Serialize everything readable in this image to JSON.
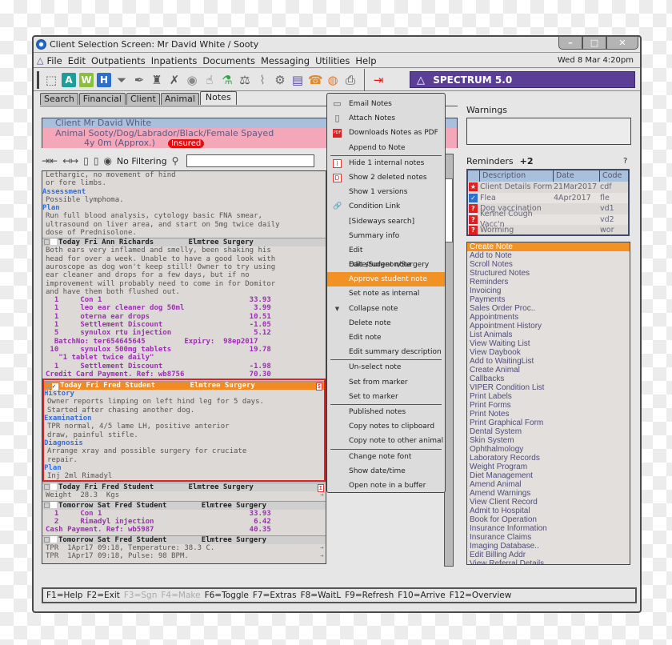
{
  "window": {
    "title": "Client Selection Screen: Mr David White / Sooty",
    "controls": [
      "–",
      "□",
      "✕"
    ]
  },
  "menubar": {
    "items": [
      "File",
      "Edit",
      "Outpatients",
      "Inpatients",
      "Documents",
      "Messaging",
      "Utilities",
      "Help"
    ],
    "datetime": "Wed 8 Mar 4:20pm"
  },
  "toolbar": {
    "icons": [
      {
        "name": "select-area-icon",
        "glyph": "⬚",
        "color": "#555555"
      },
      {
        "name": "a-icon",
        "glyph": "A",
        "color": "#1f9d9a",
        "letter": true
      },
      {
        "name": "w-icon",
        "glyph": "W",
        "color": "#8cbf3f",
        "letter": true
      },
      {
        "name": "h-icon",
        "glyph": "H",
        "color": "#2d6fc9",
        "letter": true
      },
      {
        "name": "funnel-icon",
        "glyph": "⏷",
        "color": "#666666"
      },
      {
        "name": "pen-icon",
        "glyph": "✒",
        "color": "#666666"
      },
      {
        "name": "tooth-icon",
        "glyph": "♜",
        "color": "#555555"
      },
      {
        "name": "figure-icon",
        "glyph": "✗",
        "color": "#555555"
      },
      {
        "name": "eye-icon",
        "glyph": "◉",
        "color": "#888888"
      },
      {
        "name": "glove-icon",
        "glyph": "☝",
        "color": "#666666"
      },
      {
        "name": "flask-icon",
        "glyph": "⚗",
        "color": "#3aa14b"
      },
      {
        "name": "scale-icon",
        "glyph": "⚖",
        "color": "#555555"
      },
      {
        "name": "paperclip-icon",
        "glyph": "⌇",
        "color": "#888888"
      },
      {
        "name": "gears-icon",
        "glyph": "⚙",
        "color": "#666666"
      },
      {
        "name": "chart-doc-icon",
        "glyph": "▤",
        "color": "#5a4fa0"
      },
      {
        "name": "phone-bell-icon",
        "glyph": "☎",
        "color": "#e08a2a"
      },
      {
        "name": "lifebuoy-icon",
        "glyph": "◍",
        "color": "#e87722"
      },
      {
        "name": "printer-icon",
        "glyph": "⎙",
        "color": "#444444"
      }
    ],
    "exit_icon": {
      "name": "exit-door-icon",
      "glyph": "⇥",
      "color": "#e02020"
    },
    "brand": "SPECTRUM 5.0",
    "brand_color": "#5b3f97"
  },
  "tabs": [
    {
      "label": "Search",
      "active": false
    },
    {
      "label": "Financial",
      "active": false
    },
    {
      "label": "Client",
      "active": false
    },
    {
      "label": "Animal",
      "active": false
    },
    {
      "label": "Notes",
      "active": true
    }
  ],
  "client_info": {
    "client": "Client  Mr David White",
    "animal": "Animal Sooty/Dog/Labrador/Black/Female Spayed",
    "age": "4y 0m (Approx.)",
    "badge": "Insured"
  },
  "filterbar": {
    "filter_label": "No Filtering",
    "search_value": ""
  },
  "notes": {
    "top_lines": [
      {
        "t": "Lethargic, no movement of hind",
        "k": "text"
      },
      {
        "t": "or fore limbs.",
        "k": "text"
      },
      {
        "t": "Assessment",
        "k": "sec"
      },
      {
        "t": "Possible lymphoma.",
        "k": "text"
      },
      {
        "t": "Plan",
        "k": "sec"
      },
      {
        "t": "Run full blood analysis, cytology basic FNA smear,",
        "k": "text"
      },
      {
        "t": "ultrasound on liver area, and start on 5mg twice daily",
        "k": "text"
      },
      {
        "t": "dose of Prednisolone.",
        "k": "text"
      }
    ],
    "entries": [
      {
        "header": "Today Fri Ann Richards        Elmtree Surgery",
        "selected": false,
        "checked": false,
        "flag": "",
        "lines": [
          {
            "t": "Both ears very inflamed and smelly, been shaking his",
            "k": "text"
          },
          {
            "t": "head for over a week. Unable to have a good look with",
            "k": "text"
          },
          {
            "t": "auroscope as dog won't keep still! Owner to try using",
            "k": "text"
          },
          {
            "t": "ear cleaner and drops for a few days, but if no",
            "k": "text"
          },
          {
            "t": "improvement will probably need to come in for Domitor",
            "k": "text"
          },
          {
            "t": "and have them both flushed out.",
            "k": "text"
          },
          {
            "t": "  1     Con 1                                  33.93",
            "k": "inv"
          },
          {
            "t": "  1     leo ear cleaner dog 50ml                3.99",
            "k": "inv"
          },
          {
            "t": "  1     oterna ear drops                       10.51",
            "k": "inv"
          },
          {
            "t": "  1     Settlement Discount                    -1.05",
            "k": "inv"
          },
          {
            "t": "  5     synulox rtu injection                   5.12",
            "k": "inv"
          },
          {
            "t": "  BatchNo: ter654645645         Expiry:  98ep2017",
            "k": "inv"
          },
          {
            "t": " 10     synulox 500mg tablets                  19.78",
            "k": "inv"
          },
          {
            "t": "   \"1 tablet twice daily\"",
            "k": "inv"
          },
          {
            "t": "  1     Settlement Discount                    -1.98",
            "k": "inv"
          },
          {
            "t": "Credit Card Payment. Ref: wb8756               70.30",
            "k": "inv"
          }
        ]
      },
      {
        "header": "Today Fri Fred Student        Elmtree Surgery",
        "selected": true,
        "checked": true,
        "flag": "S",
        "lines": [
          {
            "t": "History",
            "k": "sec"
          },
          {
            "t": "Owner reports limping on left hind leg for 5 days.",
            "k": "text"
          },
          {
            "t": "Started after chasing another dog.",
            "k": "text"
          },
          {
            "t": "Examination",
            "k": "sec"
          },
          {
            "t": "TPR normal, 4/5 lame LH, positive anterior",
            "k": "text"
          },
          {
            "t": "draw, painful stifle.",
            "k": "text"
          },
          {
            "t": "Diagnosis",
            "k": "sec"
          },
          {
            "t": "Arrange xray and possible surgery for cruciate",
            "k": "text"
          },
          {
            "t": "repair.",
            "k": "text"
          },
          {
            "t": "Plan",
            "k": "sec"
          },
          {
            "t": "Inj 2ml Rimadyl",
            "k": "text"
          }
        ]
      },
      {
        "header": "Today Fri Fred Student        Elmtree Surgery",
        "selected": false,
        "checked": false,
        "flag": "I",
        "lines": [
          {
            "t": "Weight  28.3  Kgs",
            "k": "text",
            "arrow": true
          }
        ]
      },
      {
        "header": "Tomorrow Sat Fred Student        Elmtree Surgery",
        "selected": false,
        "checked": false,
        "flag": "",
        "lines": [
          {
            "t": "  1     Con 1                                  33.93",
            "k": "inv"
          },
          {
            "t": "  2     Rimadyl injection                       6.42",
            "k": "inv"
          },
          {
            "t": "Cash Payment. Ref: wb5987                      40.35",
            "k": "inv"
          }
        ]
      },
      {
        "header": "Tomorrow Sat Fred Student        Elmtree Surgery",
        "selected": false,
        "checked": false,
        "flag": "",
        "lines": [
          {
            "t": "TPR  1Apr17 09:18, Temperature: 38.3 C.",
            "k": "text",
            "arrow": true
          },
          {
            "t": "TPR  1Apr17 09:18, Pulse: 98 BPM.",
            "k": "text",
            "arrow": true
          }
        ]
      }
    ]
  },
  "context_menu": {
    "groups": [
      [
        {
          "label": "Email Notes",
          "icon": "email-icon",
          "glyph": "▭"
        },
        {
          "label": "Attach Notes",
          "icon": "clipboard-icon",
          "glyph": "▯"
        },
        {
          "label": "Downloads Notes as PDF",
          "icon": "pdf-icon",
          "glyph": "PDF"
        },
        {
          "label": "Append to Note",
          "icon": "",
          "glyph": ""
        }
      ],
      [
        {
          "label": "Hide 1 internal notes",
          "icon": "internal-note-icon",
          "glyph": "i"
        },
        {
          "label": "Show 2 deleted notes",
          "icon": "deleted-note-icon",
          "glyph": "D"
        },
        {
          "label": "Show 1 versions",
          "icon": "",
          "glyph": ""
        },
        {
          "label": "Condition Link",
          "icon": "link-icon",
          "glyph": "🔗"
        },
        {
          "label": "[Sideways search]",
          "icon": "",
          "glyph": ""
        },
        {
          "label": "Summary info",
          "icon": "",
          "glyph": ""
        },
        {
          "label": "Edit Date/Surgeon/Surgery",
          "icon": "",
          "glyph": ""
        },
        {
          "label": "Edit student note",
          "icon": "",
          "glyph": ""
        },
        {
          "label": "Approve student note",
          "icon": "",
          "glyph": "",
          "highlighted": true
        },
        {
          "label": "Set note as internal",
          "icon": "",
          "glyph": ""
        },
        {
          "label": "Collapse note",
          "icon": "triangle-down-icon",
          "glyph": "▼"
        },
        {
          "label": "Delete note",
          "icon": "",
          "glyph": ""
        },
        {
          "label": "Edit note",
          "icon": "",
          "glyph": ""
        },
        {
          "label": "Edit summary description",
          "icon": "",
          "glyph": ""
        }
      ],
      [
        {
          "label": "Un-select note",
          "icon": "",
          "glyph": ""
        },
        {
          "label": "Set from marker",
          "icon": "",
          "glyph": ""
        },
        {
          "label": "Set to marker",
          "icon": "",
          "glyph": ""
        }
      ],
      [
        {
          "label": "Published notes",
          "icon": "",
          "glyph": ""
        },
        {
          "label": "Copy notes to clipboard",
          "icon": "",
          "glyph": ""
        },
        {
          "label": "Copy note to other animal",
          "icon": "",
          "glyph": ""
        }
      ],
      [
        {
          "label": "Change note font",
          "icon": "",
          "glyph": ""
        },
        {
          "label": "Show date/time",
          "icon": "",
          "glyph": ""
        },
        {
          "label": "Open note in a buffer",
          "icon": "",
          "glyph": ""
        }
      ]
    ]
  },
  "warnings": {
    "label": "Warnings",
    "content": ""
  },
  "reminders": {
    "label": "Reminders",
    "extra": "+2",
    "help": "?",
    "columns": [
      "Description",
      "Date",
      "Code"
    ],
    "rows": [
      {
        "icon": "star-icon",
        "glyph": "★",
        "color": "#e02020",
        "description": "Client Details Form",
        "date": "21Mar2017",
        "code": "cdf"
      },
      {
        "icon": "check-icon",
        "glyph": "✓",
        "color": "#2d6fc9",
        "description": "Flea",
        "date": "4Apr2017",
        "code": "fle"
      },
      {
        "icon": "question-icon",
        "glyph": "?",
        "color": "#e02020",
        "description": "Dog vaccination",
        "date": "",
        "code": "vd1"
      },
      {
        "icon": "question-icon",
        "glyph": "?",
        "color": "#e02020",
        "description": "Kennel Cough Vacc'n",
        "date": "",
        "code": "vd2"
      },
      {
        "icon": "question-icon",
        "glyph": "?",
        "color": "#e02020",
        "description": "Worming",
        "date": "",
        "code": "wor"
      }
    ]
  },
  "actions": {
    "items": [
      "Create Note",
      "Add to Note",
      "Scroll Notes",
      "Structured Notes",
      "Reminders",
      "Invoicing",
      "Payments",
      "Sales Order Proc..",
      "Appointments",
      "Appointment History",
      "List Animals",
      "View Waiting List",
      "View Daybook",
      "Add to WaitingList",
      "Create Animal",
      "Callbacks",
      "VIPER Condition List",
      "Print Labels",
      "Print Forms",
      "Print Notes",
      "Print Graphical Form",
      "Dental System",
      "Skin System",
      "Ophthalmology",
      "Laboratory Records",
      "Weight Program",
      "Diet Management",
      "Amend Animal",
      "Amend Warnings",
      "View Client Record",
      "Admit to Hospital",
      "Book for Operation",
      "Insurance Information",
      "Insurance Claims",
      "Imaging Database..",
      "Edit Billing Addr",
      "View Referral Details"
    ],
    "highlighted_index": 0
  },
  "fkeys": [
    {
      "label": "F1=Help",
      "enabled": true
    },
    {
      "label": "F2=Exit",
      "enabled": true
    },
    {
      "label": "F3=Sgn",
      "enabled": false
    },
    {
      "label": "F4=Make",
      "enabled": false
    },
    {
      "label": "F6=Toggle",
      "enabled": true
    },
    {
      "label": "F7=Extras",
      "enabled": true
    },
    {
      "label": "F8=WaitL",
      "enabled": true
    },
    {
      "label": "F9=Refresh",
      "enabled": true
    },
    {
      "label": "F10=Arrive",
      "enabled": true
    },
    {
      "label": "F12=Overview",
      "enabled": true
    }
  ],
  "colors": {
    "accent_orange": "#f39224",
    "brand_purple": "#5b3f97",
    "client_blue": "#a8c0dc",
    "animal_pink": "#f4a7b9",
    "section_blue": "#2f6fe0",
    "invoice_purple": "#9a2fb0",
    "selection_red": "#e02020"
  }
}
